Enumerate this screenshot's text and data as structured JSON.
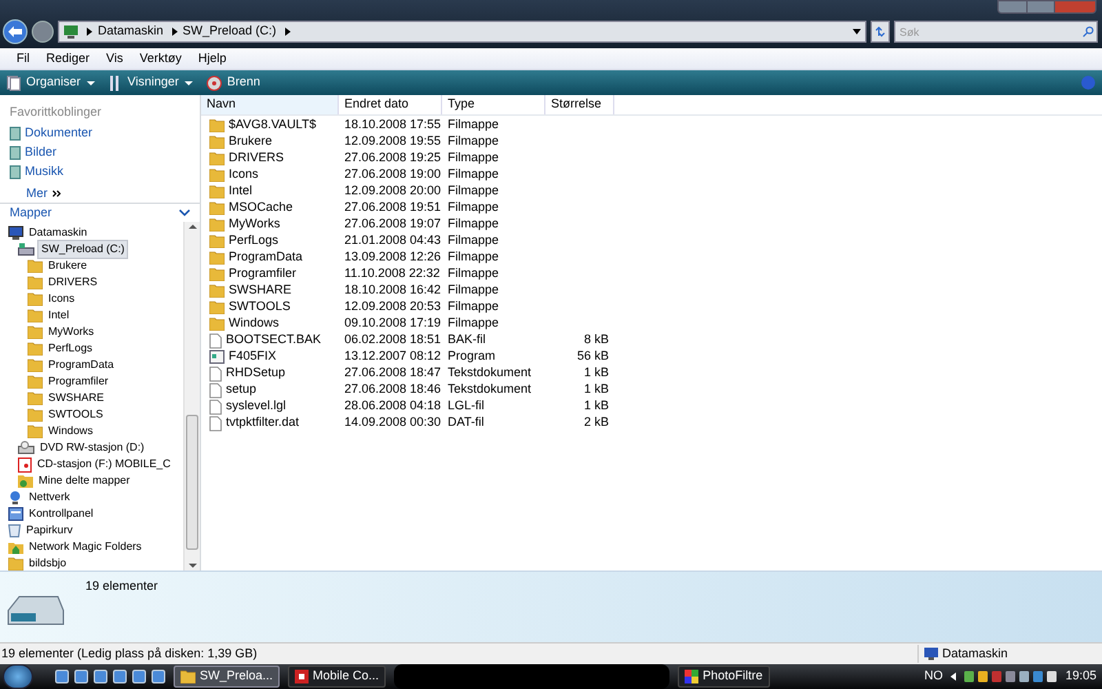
{
  "address": {
    "crumbs": [
      "Datamaskin",
      "SW_Preload (C:)"
    ]
  },
  "search": {
    "placeholder": "Søk"
  },
  "menu": [
    "Fil",
    "Rediger",
    "Vis",
    "Verktøy",
    "Hjelp"
  ],
  "toolbar": [
    {
      "label": "Organiser",
      "kind": "organise"
    },
    {
      "label": "Visninger",
      "kind": "views"
    },
    {
      "label": "Brenn",
      "kind": "burn"
    }
  ],
  "favorites": {
    "title": "Favorittkoblinger",
    "items": [
      "Dokumenter",
      "Bilder",
      "Musikk"
    ],
    "more": "Mer"
  },
  "folders": {
    "title": "Mapper",
    "tree": [
      {
        "label": "Datamaskin",
        "kind": "computer",
        "selected": false,
        "children": [
          {
            "label": "SW_Preload (C:)",
            "kind": "drive",
            "selected": true,
            "children": [
              {
                "label": "Brukere",
                "kind": "folder",
                "selected": false
              },
              {
                "label": "DRIVERS",
                "kind": "folder",
                "selected": false
              },
              {
                "label": "Icons",
                "kind": "folder",
                "selected": false
              },
              {
                "label": "Intel",
                "kind": "folder",
                "selected": false
              },
              {
                "label": "MyWorks",
                "kind": "folder",
                "selected": false
              },
              {
                "label": "PerfLogs",
                "kind": "folder",
                "selected": false
              },
              {
                "label": "ProgramData",
                "kind": "folder",
                "selected": false
              },
              {
                "label": "Programfiler",
                "kind": "folder",
                "selected": false
              },
              {
                "label": "SWSHARE",
                "kind": "folder",
                "selected": false
              },
              {
                "label": "SWTOOLS",
                "kind": "folder",
                "selected": false
              },
              {
                "label": "Windows",
                "kind": "folder",
                "selected": false
              }
            ]
          },
          {
            "label": "DVD RW-stasjon (D:)",
            "kind": "dvd",
            "selected": false
          },
          {
            "label": "CD-stasjon (F:) MOBILE_C",
            "kind": "cd",
            "selected": false
          },
          {
            "label": "Mine delte mapper",
            "kind": "share",
            "selected": false
          }
        ]
      },
      {
        "label": "Nettverk",
        "kind": "network",
        "selected": false
      },
      {
        "label": "Kontrollpanel",
        "kind": "control",
        "selected": false
      },
      {
        "label": "Papirkurv",
        "kind": "trash",
        "selected": false
      },
      {
        "label": "Network Magic Folders",
        "kind": "magic",
        "selected": false
      },
      {
        "label": "bildsbjo",
        "kind": "folder",
        "selected": false
      }
    ]
  },
  "table": {
    "columns": [
      "Navn",
      "Endret dato",
      "Type",
      "Størrelse"
    ],
    "rows": [
      {
        "kind": "folder",
        "name": "$AVG8.VAULT$",
        "date": "18.10.2008 17:55",
        "type": "Filmappe"
      },
      {
        "kind": "folder",
        "name": "Brukere",
        "date": "12.09.2008 19:55",
        "type": "Filmappe"
      },
      {
        "kind": "folder",
        "name": "DRIVERS",
        "date": "27.06.2008 19:25",
        "type": "Filmappe"
      },
      {
        "kind": "folder",
        "name": "Icons",
        "date": "27.06.2008 19:00",
        "type": "Filmappe"
      },
      {
        "kind": "folder",
        "name": "Intel",
        "date": "12.09.2008 20:00",
        "type": "Filmappe"
      },
      {
        "kind": "folder",
        "name": "MSOCache",
        "date": "27.06.2008 19:51",
        "type": "Filmappe"
      },
      {
        "kind": "folder",
        "name": "MyWorks",
        "date": "27.06.2008 19:07",
        "type": "Filmappe"
      },
      {
        "kind": "folder",
        "name": "PerfLogs",
        "date": "21.01.2008 04:43",
        "type": "Filmappe"
      },
      {
        "kind": "folder",
        "name": "ProgramData",
        "date": "13.09.2008 12:26",
        "type": "Filmappe"
      },
      {
        "kind": "folder",
        "name": "Programfiler",
        "date": "11.10.2008 22:32",
        "type": "Filmappe"
      },
      {
        "kind": "folder",
        "name": "SWSHARE",
        "date": "18.10.2008 16:42",
        "type": "Filmappe"
      },
      {
        "kind": "folder",
        "name": "SWTOOLS",
        "date": "12.09.2008 20:53",
        "type": "Filmappe"
      },
      {
        "kind": "folder",
        "name": "Windows",
        "date": "09.10.2008 17:19",
        "type": "Filmappe"
      },
      {
        "kind": "file",
        "name": "BOOTSECT.BAK",
        "date": "06.02.2008 18:51",
        "type": "BAK-fil",
        "size": "8 kB"
      },
      {
        "kind": "program",
        "name": "F405FIX",
        "date": "13.12.2007 08:12",
        "type": "Program",
        "size": "56 kB"
      },
      {
        "kind": "file",
        "name": "RHDSetup",
        "date": "27.06.2008 18:47",
        "type": "Tekstdokument",
        "size": "1 kB"
      },
      {
        "kind": "file",
        "name": "setup",
        "date": "27.06.2008 18:46",
        "type": "Tekstdokument",
        "size": "1 kB"
      },
      {
        "kind": "file",
        "name": "syslevel.lgl",
        "date": "28.06.2008 04:18",
        "type": "LGL-fil",
        "size": "1 kB"
      },
      {
        "kind": "file",
        "name": "tvtpktfilter.dat",
        "date": "14.09.2008 00:30",
        "type": "DAT-fil",
        "size": "2 kB"
      }
    ]
  },
  "details": {
    "count": "19 elementer"
  },
  "status_bar": {
    "text": "19 elementer (Ledig plass på disken: 1,39 GB)",
    "location": "Datamaskin"
  },
  "taskbar": {
    "buttons": [
      {
        "label": "SW_Preloa...",
        "selected": true,
        "kind": "folder"
      },
      {
        "label": "Mobile Co...",
        "selected": false,
        "kind": "app"
      },
      {
        "label": "PhotoFiltre",
        "selected": false,
        "kind": "paint"
      }
    ],
    "language": "NO",
    "clock": "19:05"
  }
}
